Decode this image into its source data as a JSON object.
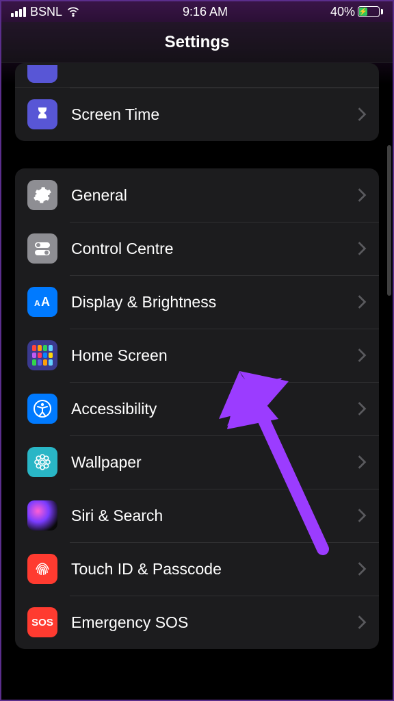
{
  "status": {
    "carrier": "BSNL",
    "time": "9:16 AM",
    "battery_pct": "40%"
  },
  "header": {
    "title": "Settings"
  },
  "group1": {
    "screen_time": "Screen Time"
  },
  "group2": {
    "general": "General",
    "control_centre": "Control Centre",
    "display": "Display & Brightness",
    "home_screen": "Home Screen",
    "accessibility": "Accessibility",
    "wallpaper": "Wallpaper",
    "siri": "Siri & Search",
    "touch_id": "Touch ID & Passcode",
    "emergency": "Emergency SOS",
    "sos_badge": "SOS"
  },
  "annotation": {
    "color": "#9b3cff"
  }
}
